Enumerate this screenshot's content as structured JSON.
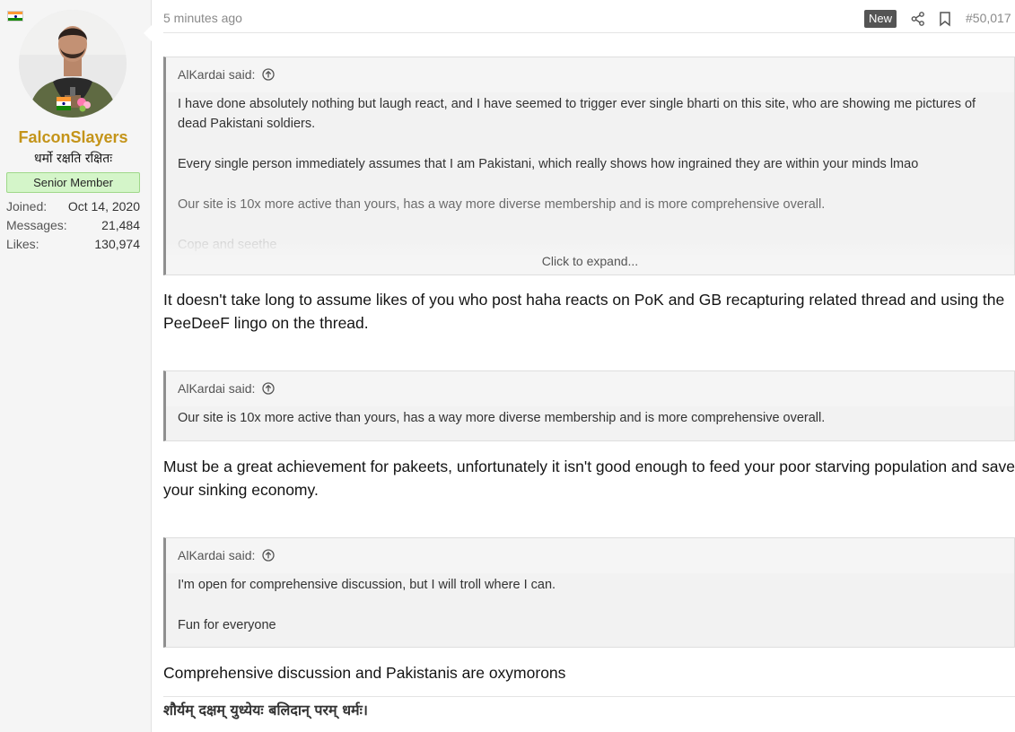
{
  "user": {
    "username": "FalconSlayers",
    "custom_title": "धर्मो रक्षति रक्षितः",
    "rank": "Senior Member",
    "stats": [
      {
        "label": "Joined:",
        "value": "Oct 14, 2020"
      },
      {
        "label": "Messages:",
        "value": "21,484"
      },
      {
        "label": "Likes:",
        "value": "130,974"
      }
    ],
    "flag_icon": "india-flag-icon",
    "avatar_icon": "user-avatar"
  },
  "post": {
    "timestamp": "5 minutes ago",
    "new_badge": "New",
    "post_number": "#50,017",
    "blocks": [
      {
        "quote_author": "AlKardai said:",
        "quote_lines": [
          "I have done absolutely nothing but laugh react, and I have seemed to trigger ever single bharti on this site, who are showing me pictures of dead Pakistani soldiers.",
          "Every single person immediately assumes that I am Pakistani, which really shows how ingrained they are within your minds lmao",
          "Our site is 10x more active than yours, has a way more diverse membership and is more comprehensive overall.",
          "Cope and seethe"
        ],
        "expand_label": "Click to expand...",
        "reply": "It doesn't take long to assume likes of you who post haha reacts on PoK and GB recapturing related thread and using the PeeDeeF lingo on the thread."
      },
      {
        "quote_author": "AlKardai said:",
        "quote_lines": [
          "Our site is 10x more active than yours, has a way more diverse membership and is more comprehensive overall."
        ],
        "reply": "Must be a great achievement for pakeets, unfortunately it isn't good enough to feed your poor starving population and save your sinking economy."
      },
      {
        "quote_author": "AlKardai said:",
        "quote_lines": [
          "I'm open for comprehensive discussion, but I will troll where I can.",
          "Fun for everyone"
        ],
        "reply": "Comprehensive discussion and Pakistanis are oxymorons"
      }
    ],
    "signature": "शौर्यम् दक्षम् युध्येयः बलिदान् परम् धर्मः।"
  },
  "colors": {
    "username": "#c49419",
    "rank_bg": "#d4f5c9",
    "badge_bg": "#545454",
    "quote_border": "#8f8f8f"
  }
}
